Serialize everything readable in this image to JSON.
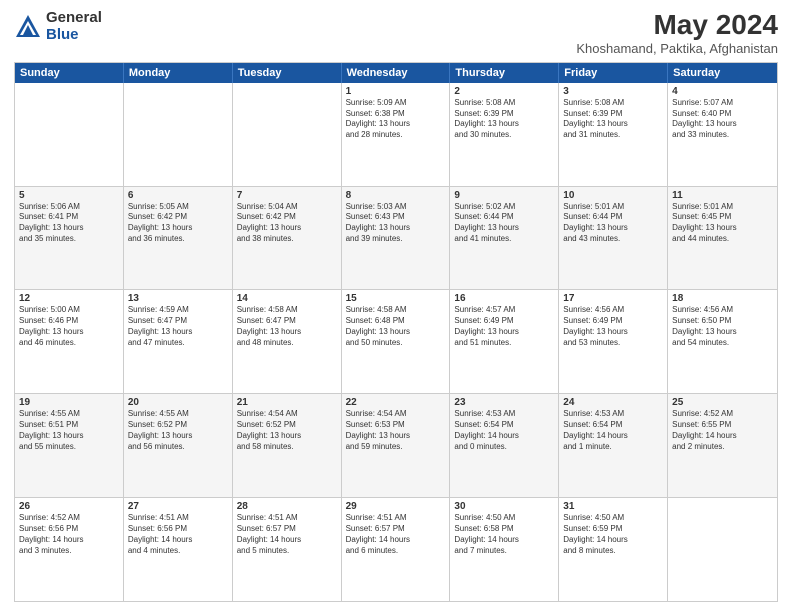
{
  "logo": {
    "general": "General",
    "blue": "Blue"
  },
  "header": {
    "title": "May 2024",
    "subtitle": "Khoshamand, Paktika, Afghanistan"
  },
  "days": [
    "Sunday",
    "Monday",
    "Tuesday",
    "Wednesday",
    "Thursday",
    "Friday",
    "Saturday"
  ],
  "weeks": [
    [
      {
        "day": "",
        "info": ""
      },
      {
        "day": "",
        "info": ""
      },
      {
        "day": "",
        "info": ""
      },
      {
        "day": "1",
        "info": "Sunrise: 5:09 AM\nSunset: 6:38 PM\nDaylight: 13 hours\nand 28 minutes."
      },
      {
        "day": "2",
        "info": "Sunrise: 5:08 AM\nSunset: 6:39 PM\nDaylight: 13 hours\nand 30 minutes."
      },
      {
        "day": "3",
        "info": "Sunrise: 5:08 AM\nSunset: 6:39 PM\nDaylight: 13 hours\nand 31 minutes."
      },
      {
        "day": "4",
        "info": "Sunrise: 5:07 AM\nSunset: 6:40 PM\nDaylight: 13 hours\nand 33 minutes."
      }
    ],
    [
      {
        "day": "5",
        "info": "Sunrise: 5:06 AM\nSunset: 6:41 PM\nDaylight: 13 hours\nand 35 minutes."
      },
      {
        "day": "6",
        "info": "Sunrise: 5:05 AM\nSunset: 6:42 PM\nDaylight: 13 hours\nand 36 minutes."
      },
      {
        "day": "7",
        "info": "Sunrise: 5:04 AM\nSunset: 6:42 PM\nDaylight: 13 hours\nand 38 minutes."
      },
      {
        "day": "8",
        "info": "Sunrise: 5:03 AM\nSunset: 6:43 PM\nDaylight: 13 hours\nand 39 minutes."
      },
      {
        "day": "9",
        "info": "Sunrise: 5:02 AM\nSunset: 6:44 PM\nDaylight: 13 hours\nand 41 minutes."
      },
      {
        "day": "10",
        "info": "Sunrise: 5:01 AM\nSunset: 6:44 PM\nDaylight: 13 hours\nand 43 minutes."
      },
      {
        "day": "11",
        "info": "Sunrise: 5:01 AM\nSunset: 6:45 PM\nDaylight: 13 hours\nand 44 minutes."
      }
    ],
    [
      {
        "day": "12",
        "info": "Sunrise: 5:00 AM\nSunset: 6:46 PM\nDaylight: 13 hours\nand 46 minutes."
      },
      {
        "day": "13",
        "info": "Sunrise: 4:59 AM\nSunset: 6:47 PM\nDaylight: 13 hours\nand 47 minutes."
      },
      {
        "day": "14",
        "info": "Sunrise: 4:58 AM\nSunset: 6:47 PM\nDaylight: 13 hours\nand 48 minutes."
      },
      {
        "day": "15",
        "info": "Sunrise: 4:58 AM\nSunset: 6:48 PM\nDaylight: 13 hours\nand 50 minutes."
      },
      {
        "day": "16",
        "info": "Sunrise: 4:57 AM\nSunset: 6:49 PM\nDaylight: 13 hours\nand 51 minutes."
      },
      {
        "day": "17",
        "info": "Sunrise: 4:56 AM\nSunset: 6:49 PM\nDaylight: 13 hours\nand 53 minutes."
      },
      {
        "day": "18",
        "info": "Sunrise: 4:56 AM\nSunset: 6:50 PM\nDaylight: 13 hours\nand 54 minutes."
      }
    ],
    [
      {
        "day": "19",
        "info": "Sunrise: 4:55 AM\nSunset: 6:51 PM\nDaylight: 13 hours\nand 55 minutes."
      },
      {
        "day": "20",
        "info": "Sunrise: 4:55 AM\nSunset: 6:52 PM\nDaylight: 13 hours\nand 56 minutes."
      },
      {
        "day": "21",
        "info": "Sunrise: 4:54 AM\nSunset: 6:52 PM\nDaylight: 13 hours\nand 58 minutes."
      },
      {
        "day": "22",
        "info": "Sunrise: 4:54 AM\nSunset: 6:53 PM\nDaylight: 13 hours\nand 59 minutes."
      },
      {
        "day": "23",
        "info": "Sunrise: 4:53 AM\nSunset: 6:54 PM\nDaylight: 14 hours\nand 0 minutes."
      },
      {
        "day": "24",
        "info": "Sunrise: 4:53 AM\nSunset: 6:54 PM\nDaylight: 14 hours\nand 1 minute."
      },
      {
        "day": "25",
        "info": "Sunrise: 4:52 AM\nSunset: 6:55 PM\nDaylight: 14 hours\nand 2 minutes."
      }
    ],
    [
      {
        "day": "26",
        "info": "Sunrise: 4:52 AM\nSunset: 6:56 PM\nDaylight: 14 hours\nand 3 minutes."
      },
      {
        "day": "27",
        "info": "Sunrise: 4:51 AM\nSunset: 6:56 PM\nDaylight: 14 hours\nand 4 minutes."
      },
      {
        "day": "28",
        "info": "Sunrise: 4:51 AM\nSunset: 6:57 PM\nDaylight: 14 hours\nand 5 minutes."
      },
      {
        "day": "29",
        "info": "Sunrise: 4:51 AM\nSunset: 6:57 PM\nDaylight: 14 hours\nand 6 minutes."
      },
      {
        "day": "30",
        "info": "Sunrise: 4:50 AM\nSunset: 6:58 PM\nDaylight: 14 hours\nand 7 minutes."
      },
      {
        "day": "31",
        "info": "Sunrise: 4:50 AM\nSunset: 6:59 PM\nDaylight: 14 hours\nand 8 minutes."
      },
      {
        "day": "",
        "info": ""
      }
    ]
  ]
}
